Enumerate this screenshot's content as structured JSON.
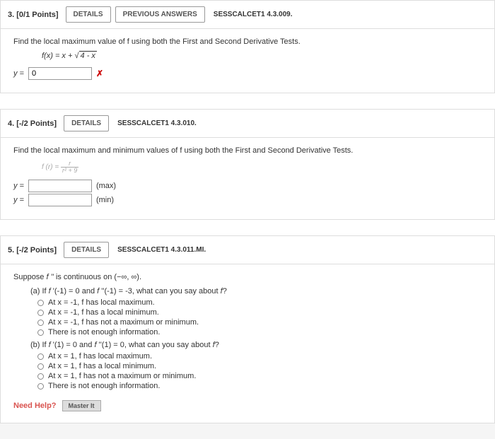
{
  "q3": {
    "header_points": "3. [0/1 Points]",
    "details_btn": "DETAILS",
    "prev_btn": "PREVIOUS ANSWERS",
    "ref": "SESSCALCET1 4.3.009.",
    "prompt": "Find the local maximum value of f using both the First and Second Derivative Tests.",
    "formula_lhs": "f(x) = x + ",
    "formula_rad": "√",
    "formula_inner": "4 - x",
    "answer_label": "y =",
    "answer_value": "0",
    "mark": "✗"
  },
  "q4": {
    "header_points": "4. [-/2 Points]",
    "details_btn": "DETAILS",
    "ref": "SESSCALCET1 4.3.010.",
    "prompt": "Find the local maximum and minimum values of f using both the First and Second Derivative Tests.",
    "formula": "f (r) =",
    "frac_num": "r",
    "frac_den": "r² + 9",
    "row1_label": "y =",
    "row1_tag": "(max)",
    "row2_label": "y =",
    "row2_tag": "(min)"
  },
  "q5": {
    "header_points": "5. [-/2 Points]",
    "details_btn": "DETAILS",
    "ref": "SESSCALCET1 4.3.011.MI.",
    "prompt": "Suppose f '' is continuous on (−∞, ∞).",
    "a_head": "(a) If f '(-1) = 0 and f ''(-1) = -3, what can you say about f?",
    "a_opts": [
      "At x = -1, f has local maximum.",
      "At x = -1, f has a local minimum.",
      "At x = -1, f has not a maximum or minimum.",
      "There is not enough information."
    ],
    "b_head": "(b) If f '(1) = 0 and f ''(1) = 0, what can you say about f?",
    "b_opts": [
      "At x = 1, f has local maximum.",
      "At x = 1, f has a local minimum.",
      "At x = 1, f has not a maximum or minimum.",
      "There is not enough information."
    ],
    "need_help": "Need Help?",
    "master_it": "Master It"
  }
}
